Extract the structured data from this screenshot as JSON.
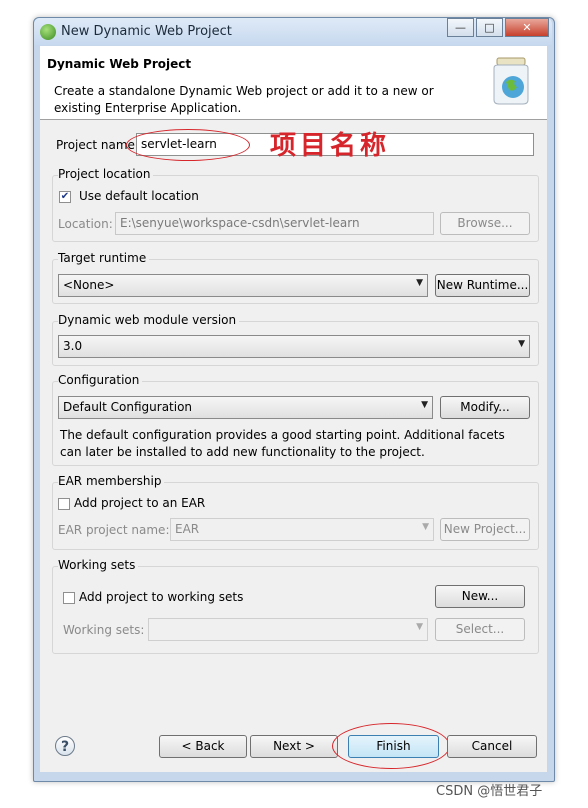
{
  "window": {
    "title": "New Dynamic Web Project",
    "controls": [
      "—",
      "□",
      "✕"
    ]
  },
  "banner": {
    "title": "Dynamic Web Project",
    "description": "Create a standalone Dynamic Web project or add it to a new or existing Enterprise Application."
  },
  "project_name": {
    "label": "Project name:",
    "value": "servlet-learn",
    "annotation": "项目名称"
  },
  "location": {
    "group_label": "Project location",
    "use_default_label": "Use default location",
    "use_default_checked": true,
    "location_label": "Location:",
    "location_value": "E:\\senyue\\workspace-csdn\\servlet-learn",
    "browse_label": "Browse..."
  },
  "runtime": {
    "group_label": "Target runtime",
    "selected": "<None>",
    "new_runtime_label": "New Runtime..."
  },
  "module_version": {
    "group_label": "Dynamic web module version",
    "selected": "3.0"
  },
  "configuration": {
    "group_label": "Configuration",
    "selected": "Default Configuration",
    "modify_label": "Modify...",
    "description": "The default configuration provides a good starting point. Additional facets can later be installed to add new functionality to the project."
  },
  "ear": {
    "group_label": "EAR membership",
    "add_label": "Add project to an EAR",
    "add_checked": false,
    "name_label": "EAR project name:",
    "name_value": "EAR",
    "new_project_label": "New Project..."
  },
  "working_sets": {
    "group_label": "Working sets",
    "add_label": "Add project to working sets",
    "add_checked": false,
    "new_label": "New...",
    "sets_label": "Working sets:",
    "sets_value": "",
    "select_label": "Select..."
  },
  "footer": {
    "help_symbol": "?",
    "back_label": "< Back",
    "next_label": "Next >",
    "finish_label": "Finish",
    "cancel_label": "Cancel"
  },
  "watermark": "CSDN @悟世君子",
  "colors": {
    "annotation_red": "#d6262b",
    "title_bar": "#c7d9ef",
    "finish_border": "#3c7fb1"
  }
}
